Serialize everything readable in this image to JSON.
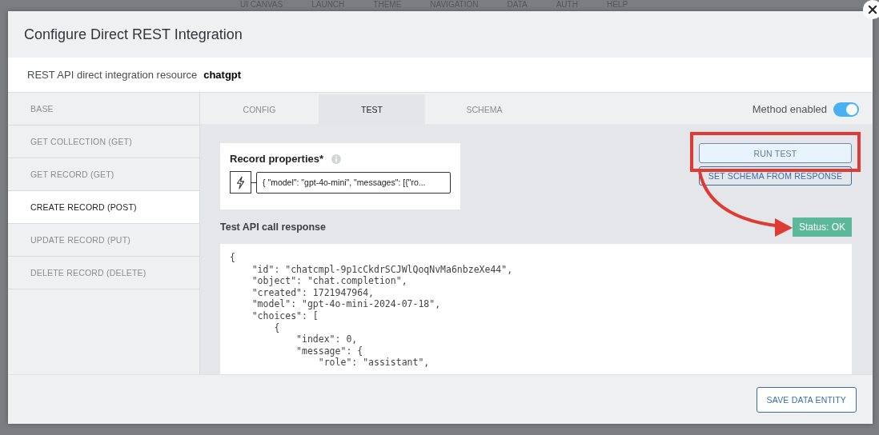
{
  "background_nav": [
    "UI CANVAS",
    "LAUNCH",
    "THEME",
    "NAVIGATION",
    "DATA",
    "AUTH",
    "HELP"
  ],
  "dialog": {
    "title": "Configure Direct REST Integration",
    "resource": {
      "label": "REST API direct integration resource",
      "value": "chatgpt"
    },
    "sidebar": {
      "items": [
        {
          "label": "BASE",
          "selected": false
        },
        {
          "label": "GET COLLECTION (GET)",
          "selected": false
        },
        {
          "label": "GET RECORD (GET)",
          "selected": false
        },
        {
          "label": "CREATE RECORD (POST)",
          "selected": true
        },
        {
          "label": "UPDATE RECORD (PUT)",
          "selected": false
        },
        {
          "label": "DELETE RECORD (DELETE)",
          "selected": false
        }
      ]
    },
    "tabs": [
      {
        "label": "CONFIG",
        "selected": false
      },
      {
        "label": "TEST",
        "selected": true
      },
      {
        "label": "SCHEMA",
        "selected": false
      }
    ],
    "method_toggle": {
      "label": "Method enabled",
      "on": true
    },
    "record_properties": {
      "label": "Record properties*",
      "value": "{ \"model\": \"gpt-4o-mini\", \"messages\": [{\"ro..."
    },
    "buttons": [
      {
        "label": "RUN TEST",
        "kind": "primary"
      },
      {
        "label": "SET SCHEMA FROM RESPONSE",
        "kind": "outline"
      }
    ],
    "response": {
      "label": "Test API call response",
      "status": "Status: OK",
      "lines": [
        "{",
        "    \"id\": \"chatcmpl-9p1cCkdrSCJWlQoqNvMa6nbzeXe44\",",
        "    \"object\": \"chat.completion\",",
        "    \"created\": 1721947964,",
        "    \"model\": \"gpt-4o-mini-2024-07-18\",",
        "    \"choices\": [",
        "        {",
        "            \"index\": 0,",
        "            \"message\": {",
        "                \"role\": \"assistant\","
      ]
    },
    "footer_button": "SAVE DATA ENTITY"
  }
}
